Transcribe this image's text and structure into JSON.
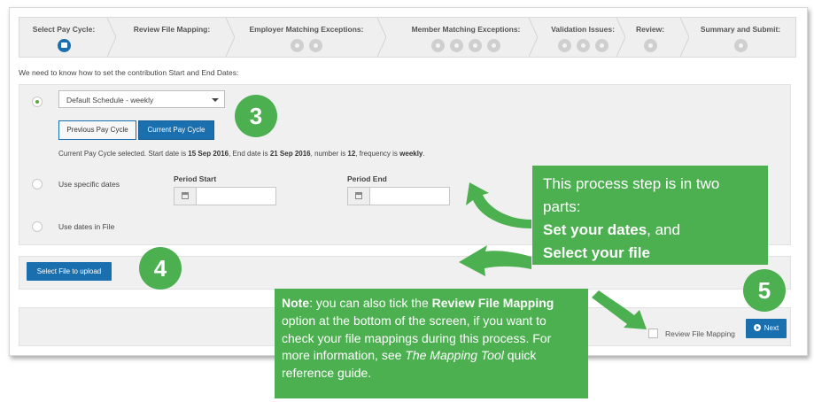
{
  "wizard": {
    "steps": [
      {
        "label": "Select Pay Cycle:",
        "icons": [
          "calendar-icon"
        ]
      },
      {
        "label": "Review File Mapping:",
        "icons": []
      },
      {
        "label": "Employer Matching Exceptions:",
        "icons": [
          "step-dot-icon",
          "step-dot-icon"
        ]
      },
      {
        "label": "Member Matching Exceptions:",
        "icons": [
          "step-dot-icon",
          "step-dot-icon",
          "step-dot-icon",
          "step-dot-icon"
        ]
      },
      {
        "label": "Validation Issues:",
        "icons": [
          "step-dot-icon",
          "step-dot-icon",
          "step-dot-icon"
        ]
      },
      {
        "label": "Review:",
        "icons": [
          "step-dot-icon"
        ]
      },
      {
        "label": "Summary and Submit:",
        "icons": [
          "step-dot-icon"
        ]
      }
    ]
  },
  "intro_text": "We need to know how to set the contribution Start and End Dates:",
  "schedule": {
    "selected": "Default Schedule - weekly",
    "prev_label": "Previous Pay Cycle",
    "current_label": "Current Pay Cycle",
    "info": {
      "p1": "Current Pay Cycle selected. Start date is ",
      "start": "15 Sep 2016",
      "p2": ", End date is ",
      "end": "21 Sep 2016",
      "p3": ", number is ",
      "number": "12",
      "p4": ", frequency is ",
      "frequency": "weekly",
      "p5": "."
    }
  },
  "specific_dates": {
    "label": "Use specific dates",
    "period_start": "Period Start",
    "period_end": "Period End"
  },
  "dates_in_file_label": "Use dates in File",
  "select_file_label": "Select File to upload",
  "review_mapping_label": "Review File Mapping",
  "next_label": "Next",
  "badges": {
    "b3": "3",
    "b4": "4",
    "b5": "5"
  },
  "callout1": {
    "l1": "This process step is in two parts:",
    "set_dates": "Set your dates",
    "and": ", and",
    "select_file": "Select your file"
  },
  "callout2": {
    "note": "Note",
    "t1": ":  you can also  tick the ",
    "review": "Review File Mapping",
    "t2": " option at the bottom of the screen, if you want to check your file mappings during this process. For more information, see ",
    "tool": "The Mapping Tool",
    "t3": " quick reference guide."
  },
  "colors": {
    "accent": "#1a6faf",
    "callout": "#4caf50",
    "radio_on": "#5aa93a"
  }
}
